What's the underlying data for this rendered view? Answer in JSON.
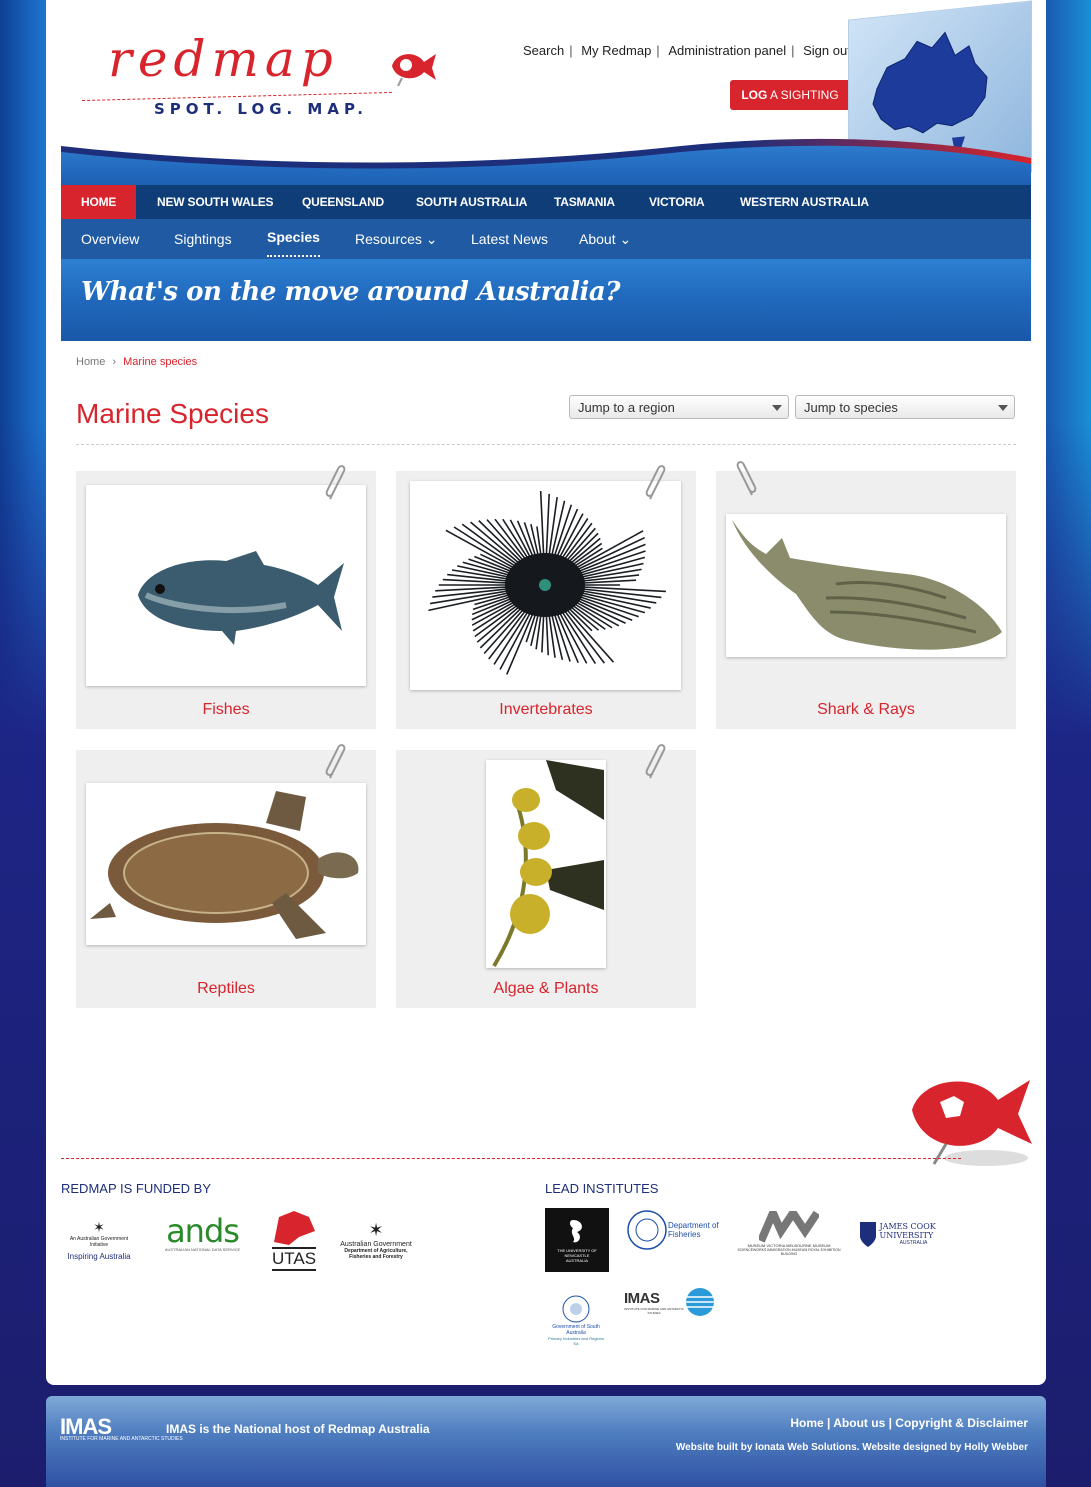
{
  "header": {
    "logo_word": "redmap",
    "logo_tagline": "SPOT. LOG. MAP.",
    "top_links": [
      "Search",
      "My Redmap",
      "Administration panel",
      "Sign out"
    ],
    "log_button": {
      "bold": "LOG",
      "rest": " A SIGHTING"
    }
  },
  "nav_primary": {
    "home": "HOME",
    "items": [
      "NEW SOUTH WALES",
      "QUEENSLAND",
      "SOUTH AUSTRALIA",
      "TASMANIA",
      "VICTORIA",
      "WESTERN AUSTRALIA"
    ]
  },
  "nav_secondary": {
    "items": [
      "Overview",
      "Sightings",
      "Species",
      "Resources ⌄",
      "Latest News",
      "About ⌄"
    ],
    "active": "Species"
  },
  "banner": {
    "text": "What's on the move around Australia?"
  },
  "breadcrumb": {
    "home": "Home",
    "separator": "›",
    "current": "Marine species"
  },
  "page": {
    "title": "Marine Species",
    "region_select": "Jump to a region",
    "species_select": "Jump to species"
  },
  "categories": [
    {
      "label": "Fishes",
      "icon": "fish"
    },
    {
      "label": "Invertebrates",
      "icon": "sea-urchin"
    },
    {
      "label": "Shark & Rays",
      "icon": "shovelnose-ray"
    },
    {
      "label": "Reptiles",
      "icon": "sea-turtle"
    },
    {
      "label": "Algae & Plants",
      "icon": "kelp"
    }
  ],
  "funders": {
    "heading": "REDMAP IS FUNDED BY",
    "logos": [
      {
        "name": "An Australian Government Initiative",
        "sub": "Inspiring Australia"
      },
      {
        "name": "ands",
        "sub": "AUSTRALIAN NATIONAL DATA SERVICE"
      },
      {
        "name": "UTAS"
      },
      {
        "name": "Australian Government",
        "sub": "Department of Agriculture, Fisheries and Forestry"
      }
    ]
  },
  "institutes": {
    "heading": "LEAD INSTITUTES",
    "logos": [
      {
        "name": "THE UNIVERSITY OF NEWCASTLE",
        "sub": "AUSTRALIA"
      },
      {
        "name": "Department of Fisheries"
      },
      {
        "name": "MUSEUM VICTORIA MELBOURNE MUSEUM",
        "sub": "SCIENCEWORKS IMMIGRATION MUSEUM ROYAL EXHIBITION BUILDING"
      },
      {
        "name": "JAMES COOK UNIVERSITY",
        "sub": "AUSTRALIA"
      },
      {
        "name": "Government of South Australia",
        "sub": "Primary Industries and Regions SA"
      },
      {
        "name": "IMAS",
        "sub": "INSTITUTE FOR MARINE AND ANTARCTIC STUDIES"
      }
    ]
  },
  "footer": {
    "imas": "IMAS",
    "imas_sub": "INSTITUTE FOR MARINE AND ANTARCTIC STUDIES",
    "host_text": "IMAS is the National host of Redmap Australia",
    "links": [
      "Home",
      "About us",
      "Copyright & Disclaimer"
    ],
    "built_by": "Website built by Ionata Web Solutions. Website designed by Holly Webber"
  },
  "colors": {
    "brand_red": "#d8242c",
    "nav_dark": "#0f3d78",
    "nav_blue": "#1f5aa2",
    "navy": "#1d2f7a"
  }
}
